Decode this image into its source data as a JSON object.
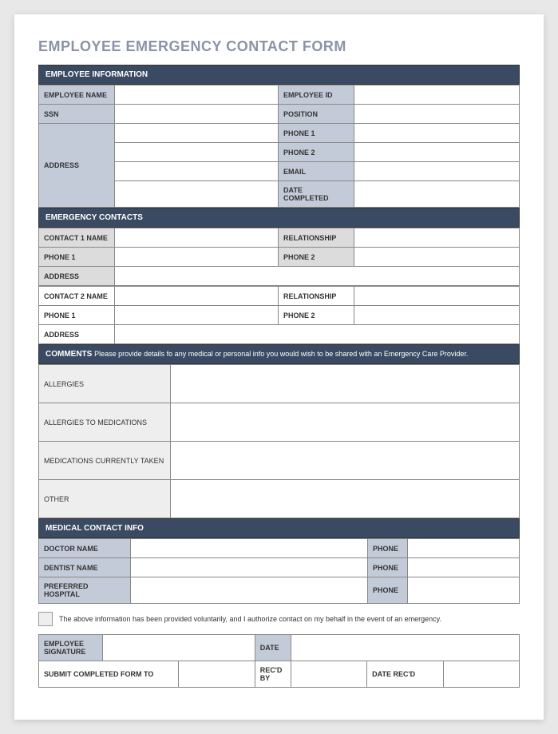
{
  "title": "EMPLOYEE EMERGENCY CONTACT FORM",
  "sections": {
    "employee_info": {
      "header": "EMPLOYEE INFORMATION",
      "employee_name": "EMPLOYEE NAME",
      "employee_id": "EMPLOYEE ID",
      "ssn": "SSN",
      "position": "POSITION",
      "address": "ADDRESS",
      "phone1": "PHONE 1",
      "phone2": "PHONE 2",
      "email": "EMAIL",
      "date_completed": "DATE COMPLETED"
    },
    "emergency_contacts": {
      "header": "EMERGENCY CONTACTS",
      "contact1_name": "CONTACT 1 NAME",
      "relationship": "RELATIONSHIP",
      "phone1": "PHONE 1",
      "phone2": "PHONE 2",
      "address": "ADDRESS",
      "contact2_name": "CONTACT 2 NAME"
    },
    "comments": {
      "header_label": "COMMENTS",
      "header_sub": "Please provide details fo any medical or personal info you would wish to be shared with an Emergency Care Provider.",
      "allergies": "ALLERGIES",
      "allergies_meds": "ALLERGIES TO MEDICATIONS",
      "meds_current": "MEDICATIONS CURRENTLY TAKEN",
      "other": "OTHER"
    },
    "medical": {
      "header": "MEDICAL CONTACT INFO",
      "doctor": "DOCTOR NAME",
      "dentist": "DENTIST NAME",
      "hospital": "PREFERRED HOSPITAL",
      "phone": "PHONE"
    },
    "consent": "The above information has been provided voluntarily, and I authorize contact on my behalf in the event of an emergency.",
    "signature": {
      "employee_sig": "EMPLOYEE SIGNATURE",
      "date": "DATE",
      "submit_to": "SUBMIT COMPLETED FORM TO",
      "recd_by": "REC'D BY",
      "date_recd": "DATE REC'D"
    }
  }
}
